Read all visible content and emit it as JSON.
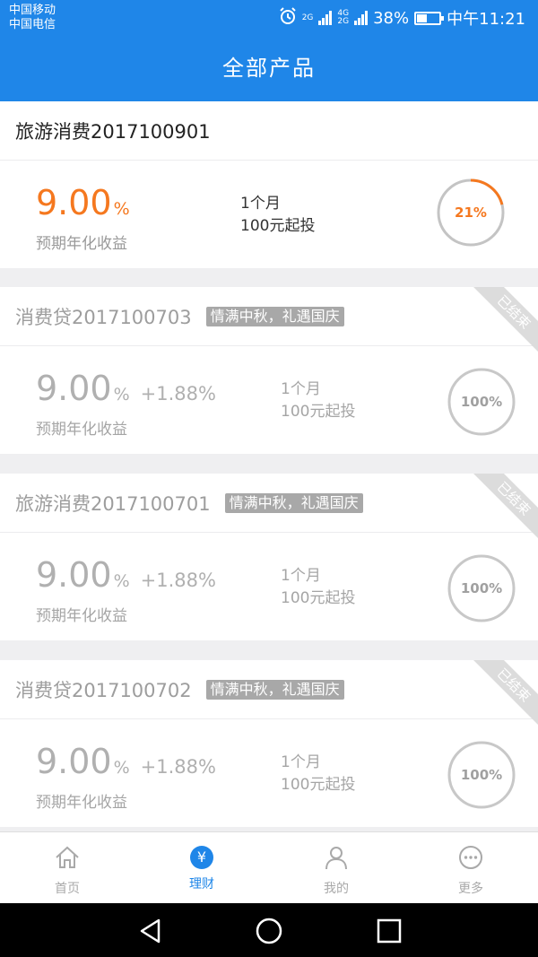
{
  "status_bar": {
    "carrier_1": "中国移动",
    "carrier_2": "中国电信",
    "net_1": "2G",
    "net_2a": "4G",
    "net_2b": "2G",
    "battery": "38%",
    "time": "中午11:21"
  },
  "header": {
    "title": "全部产品"
  },
  "products": [
    {
      "name": "旅游消费2017100901",
      "tag": "",
      "rate": "9.00",
      "rate_unit": "%",
      "bonus": "",
      "rate_label": "预期年化收益",
      "term": "1个月",
      "min_invest": "100元起投",
      "progress_text": "21%",
      "progress": 0.21,
      "ended": false,
      "ribbon": ""
    },
    {
      "name": "消费贷2017100703",
      "tag": "情满中秋，礼遇国庆",
      "rate": "9.00",
      "rate_unit": "%",
      "bonus": "+1.88%",
      "rate_label": "预期年化收益",
      "term": "1个月",
      "min_invest": "100元起投",
      "progress_text": "100%",
      "progress": 1.0,
      "ended": true,
      "ribbon": "已结束"
    },
    {
      "name": "旅游消费2017100701",
      "tag": "情满中秋，礼遇国庆",
      "rate": "9.00",
      "rate_unit": "%",
      "bonus": "+1.88%",
      "rate_label": "预期年化收益",
      "term": "1个月",
      "min_invest": "100元起投",
      "progress_text": "100%",
      "progress": 1.0,
      "ended": true,
      "ribbon": "已结束"
    },
    {
      "name": "消费贷2017100702",
      "tag": "情满中秋，礼遇国庆",
      "rate": "9.00",
      "rate_unit": "%",
      "bonus": "+1.88%",
      "rate_label": "预期年化收益",
      "term": "1个月",
      "min_invest": "100元起投",
      "progress_text": "100%",
      "progress": 1.0,
      "ended": true,
      "ribbon": "已结束"
    }
  ],
  "tabbar": {
    "items": [
      {
        "label": "首页",
        "icon": "home-icon",
        "active": false
      },
      {
        "label": "理财",
        "icon": "yen-icon",
        "active": true,
        "glyph": "¥"
      },
      {
        "label": "我的",
        "icon": "person-icon",
        "active": false
      },
      {
        "label": "更多",
        "icon": "more-icon",
        "active": false
      }
    ]
  },
  "colors": {
    "primary": "#1f86e8",
    "accent": "#f5781f",
    "muted": "#b0b0b0"
  }
}
